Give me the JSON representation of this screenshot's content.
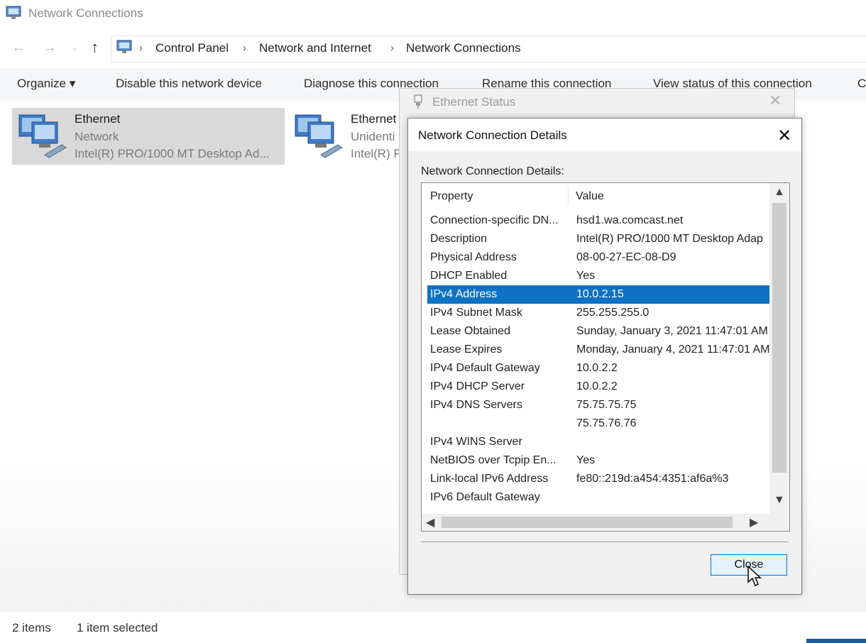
{
  "window": {
    "title": "Network Connections",
    "icon": "network-connections-icon"
  },
  "address": {
    "breadcrumb": [
      "Control Panel",
      "Network and Internet",
      "Network Connections"
    ]
  },
  "toolbar": {
    "organize": "Organize ▾",
    "disable": "Disable this network device",
    "diagnose": "Diagnose this connection",
    "rename": "Rename this connection",
    "view_status": "View status of this connection",
    "more": "C"
  },
  "items": [
    {
      "name": "Ethernet",
      "status": "Network",
      "adapter": "Intel(R) PRO/1000 MT Desktop Ad..."
    },
    {
      "name": "Ethernet",
      "status": "Unidenti",
      "adapter": "Intel(R) P"
    }
  ],
  "statusbar": {
    "count": "2 items",
    "selected": "1 item selected"
  },
  "status_dialog": {
    "title": "Ethernet Status"
  },
  "details_dialog": {
    "title": "Network Connection Details",
    "caption": "Network Connection Details:",
    "columns": {
      "property": "Property",
      "value": "Value"
    },
    "rows": [
      {
        "property": "Connection-specific DN...",
        "value": "hsd1.wa.comcast.net"
      },
      {
        "property": "Description",
        "value": "Intel(R) PRO/1000 MT Desktop Adap"
      },
      {
        "property": "Physical Address",
        "value": "08-00-27-EC-08-D9"
      },
      {
        "property": "DHCP Enabled",
        "value": "Yes"
      },
      {
        "property": "IPv4 Address",
        "value": "10.0.2.15",
        "selected": true
      },
      {
        "property": "IPv4 Subnet Mask",
        "value": "255.255.255.0"
      },
      {
        "property": "Lease Obtained",
        "value": "Sunday, January 3, 2021 11:47:01 AM"
      },
      {
        "property": "Lease Expires",
        "value": "Monday, January 4, 2021 11:47:01 AM"
      },
      {
        "property": "IPv4 Default Gateway",
        "value": "10.0.2.2"
      },
      {
        "property": "IPv4 DHCP Server",
        "value": "10.0.2.2"
      },
      {
        "property": "IPv4 DNS Servers",
        "value": "75.75.75.75"
      },
      {
        "property": "",
        "value": "75.75.76.76"
      },
      {
        "property": "IPv4 WINS Server",
        "value": ""
      },
      {
        "property": "NetBIOS over Tcpip En...",
        "value": "Yes"
      },
      {
        "property": "Link-local IPv6 Address",
        "value": "fe80::219d:a454:4351:af6a%3"
      },
      {
        "property": "IPv6 Default Gateway",
        "value": ""
      }
    ],
    "close_label": "Close"
  },
  "accent_color": "#0e72c4"
}
